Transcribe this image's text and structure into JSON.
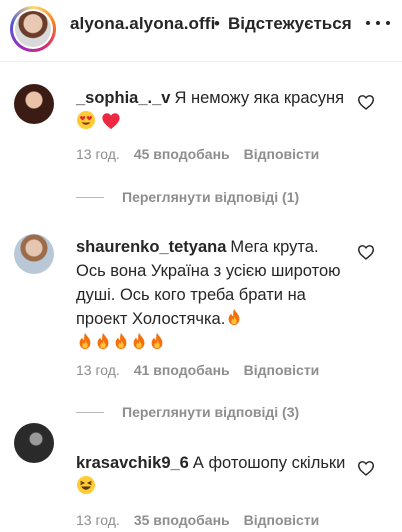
{
  "header": {
    "username": "alyona.alyona.offi",
    "separator": "•",
    "follow_status": "Відстежується",
    "more_icon": "more-horizontal-icon"
  },
  "comments": [
    {
      "username": "_sophia_._v",
      "text": "Я неможу яка красуня",
      "emojis": [
        "heart-eyes-emoji",
        "red-heart-emoji"
      ],
      "time": "13 год.",
      "likes": "45 вподобань",
      "reply": "Відповісти",
      "view_replies": "Переглянути відповіді (1)"
    },
    {
      "username": "shaurenko_tetyana",
      "text": "Мега крута. Ось вона Україна з усією широтою душі. Ось кого треба брати на проект Холостячка.",
      "emojis": [
        "fire-emoji",
        "fire-emoji",
        "fire-emoji",
        "fire-emoji",
        "fire-emoji",
        "fire-emoji"
      ],
      "time": "13 год.",
      "likes": "41 вподобань",
      "reply": "Відповісти",
      "view_replies": "Переглянути відповіді (3)"
    },
    {
      "username": "krasavchik9_6",
      "text": "А фотошопу скільки",
      "emojis": [
        "laughing-emoji"
      ],
      "time": "13 год.",
      "likes": "35 вподобань",
      "reply": "Відповісти"
    }
  ],
  "colors": {
    "text": "#262626",
    "muted": "#8e8e8e",
    "heart_red": "#ed4956",
    "fire_orange": "#f4700c"
  }
}
